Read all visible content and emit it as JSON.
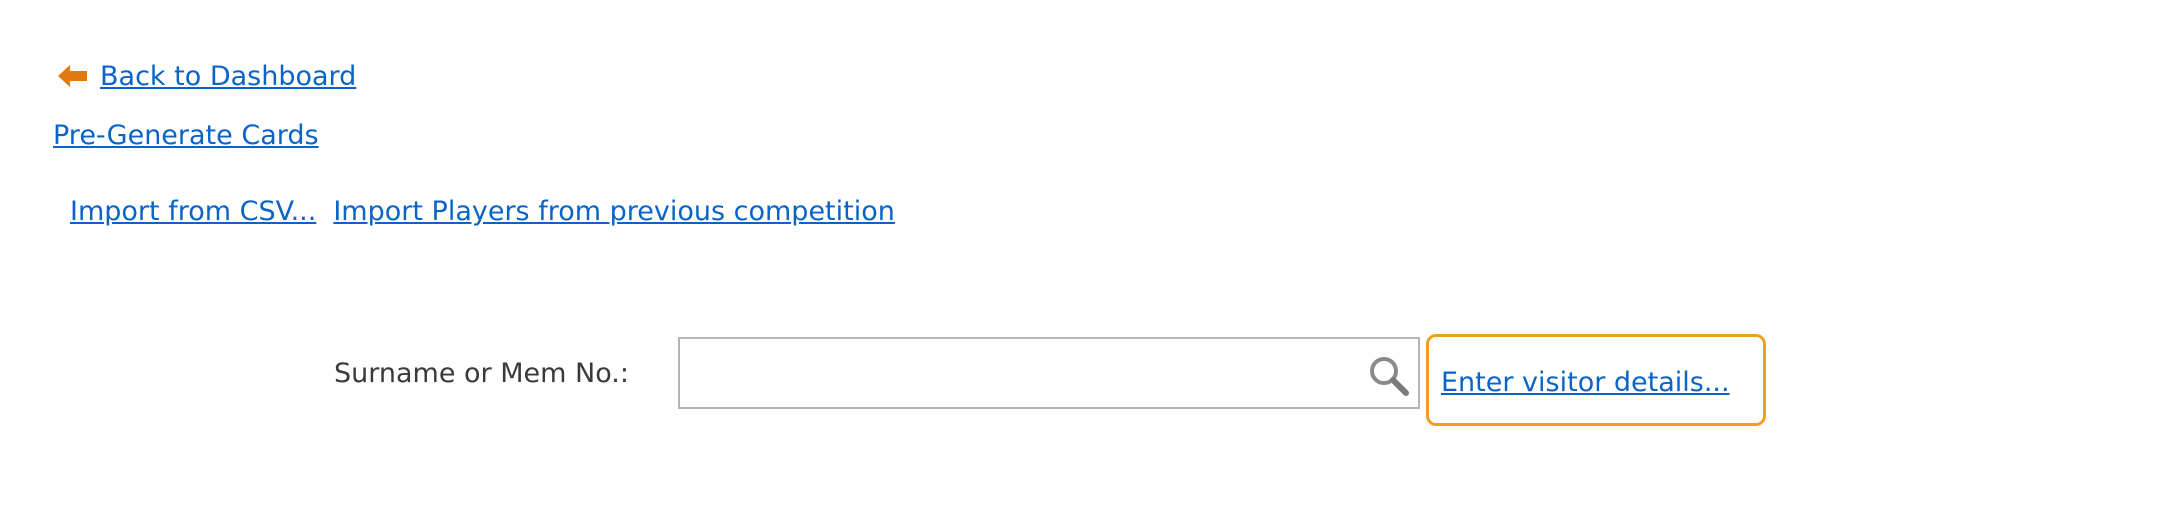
{
  "nav": {
    "back_label": "Back to Dashboard",
    "back_icon": "left-arrow-icon",
    "pregenerate_label": "Pre-Generate Cards"
  },
  "imports": {
    "csv_label": "Import from CSV...",
    "previous_label": "Import Players from previous competition"
  },
  "search": {
    "label": "Surname or Mem No.:",
    "value": "",
    "placeholder": "",
    "icon": "magnifier-icon"
  },
  "visitor": {
    "label": "Enter visitor details..."
  },
  "colors": {
    "link": "#0a64c8",
    "arrow": "#e07a10",
    "highlight_border": "#f0a020",
    "input_border": "#b5b5b5"
  }
}
